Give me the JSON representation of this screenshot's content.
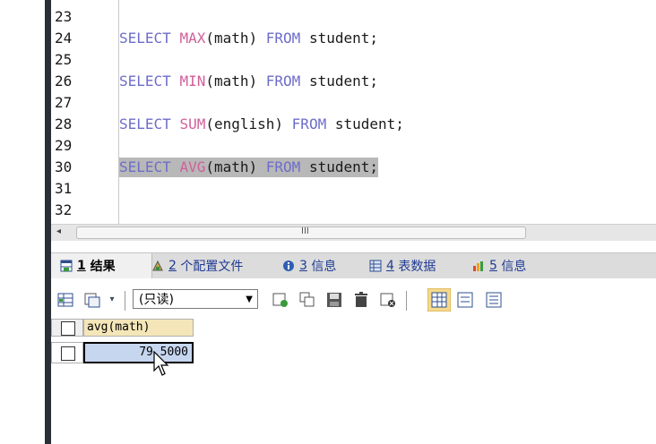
{
  "editor": {
    "lines": [
      {
        "num": "23",
        "tokens": []
      },
      {
        "num": "24",
        "tokens": [
          {
            "t": "SELECT ",
            "c": "kw"
          },
          {
            "t": "MAX",
            "c": "fn"
          },
          {
            "t": "(math) ",
            "c": ""
          },
          {
            "t": "FROM ",
            "c": "kw"
          },
          {
            "t": "student;",
            "c": ""
          }
        ]
      },
      {
        "num": "25",
        "tokens": []
      },
      {
        "num": "26",
        "tokens": [
          {
            "t": "SELECT ",
            "c": "kw"
          },
          {
            "t": "MIN",
            "c": "fn"
          },
          {
            "t": "(math) ",
            "c": ""
          },
          {
            "t": "FROM ",
            "c": "kw"
          },
          {
            "t": "student;",
            "c": ""
          }
        ]
      },
      {
        "num": "27",
        "tokens": []
      },
      {
        "num": "28",
        "tokens": [
          {
            "t": "SELECT ",
            "c": "kw"
          },
          {
            "t": "SUM",
            "c": "fn"
          },
          {
            "t": "(english) ",
            "c": ""
          },
          {
            "t": "FROM ",
            "c": "kw"
          },
          {
            "t": "student;",
            "c": ""
          }
        ]
      },
      {
        "num": "29",
        "tokens": []
      },
      {
        "num": "30",
        "tokens": [
          {
            "t": "SELECT ",
            "c": "kw"
          },
          {
            "t": "AVG",
            "c": "fn"
          },
          {
            "t": "(math) ",
            "c": ""
          },
          {
            "t": "FROM ",
            "c": "kw"
          },
          {
            "t": "student;",
            "c": ""
          }
        ],
        "highlighted": true
      },
      {
        "num": "31",
        "tokens": []
      },
      {
        "num": "32",
        "tokens": []
      }
    ]
  },
  "scrollbar": {
    "left_arrow": "◂",
    "grip": "III"
  },
  "tabs": [
    {
      "num": "1",
      "label": "结果",
      "icon": "result-grid-icon",
      "active": true
    },
    {
      "num": "2",
      "label": "个配置文件",
      "icon": "profile-icon",
      "active": false
    },
    {
      "num": "3",
      "label": "信息",
      "icon": "info-icon",
      "active": false
    },
    {
      "num": "4",
      "label": "表数据",
      "icon": "table-data-icon",
      "active": false
    },
    {
      "num": "5",
      "label": "信息",
      "icon": "info-chart-icon",
      "active": false
    }
  ],
  "toolbar": {
    "mode_select": "(只读)"
  },
  "results": {
    "column": "avg(math)",
    "rows": [
      {
        "value": "79.5000"
      }
    ]
  },
  "colors": {
    "keyword": "#6d6dc9",
    "function": "#d0609a",
    "tab_link": "#1f3a93",
    "selection": "#b8b8b8"
  }
}
